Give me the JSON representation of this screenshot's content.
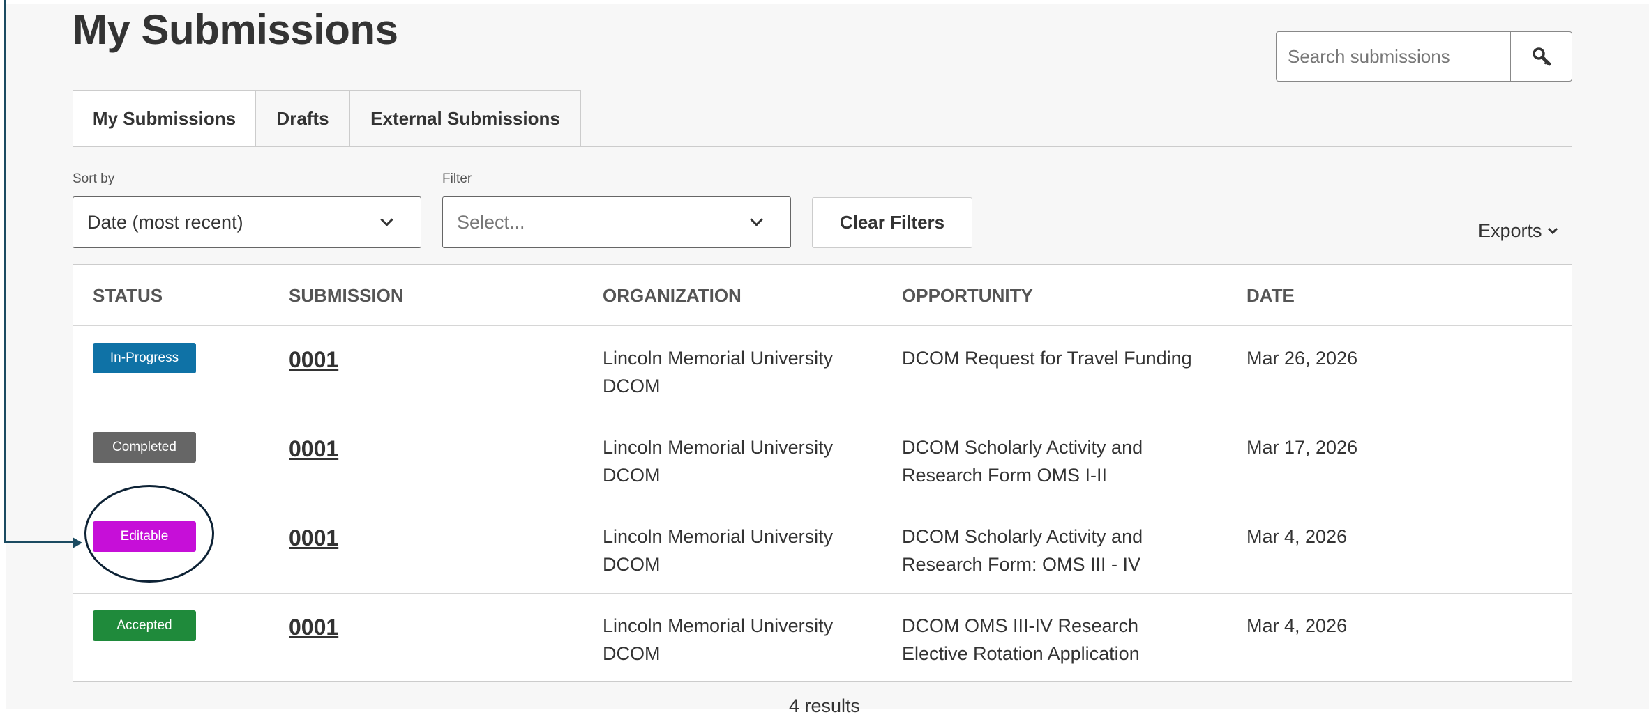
{
  "page": {
    "title": "My Submissions"
  },
  "search": {
    "placeholder": "Search submissions",
    "icon": "search-icon"
  },
  "tabs": [
    {
      "label": "My Submissions",
      "active": true
    },
    {
      "label": "Drafts",
      "active": false
    },
    {
      "label": "External Submissions",
      "active": false
    }
  ],
  "controls": {
    "sort_label": "Sort by",
    "sort_value": "Date (most recent)",
    "filter_label": "Filter",
    "filter_placeholder": "Select...",
    "clear_filters": "Clear Filters",
    "exports": "Exports"
  },
  "table": {
    "columns": [
      "STATUS",
      "SUBMISSION",
      "ORGANIZATION",
      "OPPORTUNITY",
      "DATE"
    ],
    "rows": [
      {
        "status": "In-Progress",
        "status_color": "#0f72a6",
        "submission": "0001",
        "org_line1": "Lincoln Memorial University",
        "org_line2": "DCOM",
        "opp_line1": "DCOM Request for Travel Funding",
        "opp_line2": "",
        "date": "Mar 26, 2026"
      },
      {
        "status": "Completed",
        "status_color": "#666666",
        "submission": "0001",
        "org_line1": "Lincoln Memorial University",
        "org_line2": "DCOM",
        "opp_line1": "DCOM Scholarly Activity and",
        "opp_line2": "Research Form OMS I-II",
        "date": "Mar 17, 2026"
      },
      {
        "status": "Editable",
        "status_color": "#c60fd8",
        "submission": "0001",
        "org_line1": "Lincoln Memorial University",
        "org_line2": "DCOM",
        "opp_line1": "DCOM Scholarly Activity and",
        "opp_line2": "Research Form: OMS III - IV",
        "date": "Mar 4, 2026"
      },
      {
        "status": "Accepted",
        "status_color": "#1f8a3b",
        "submission": "0001",
        "org_line1": "Lincoln Memorial University",
        "org_line2": "DCOM",
        "opp_line1": "DCOM OMS III-IV Research",
        "opp_line2": "Elective Rotation Application",
        "date": "Mar 4, 2026"
      }
    ]
  },
  "results": {
    "count_text": "4 results"
  },
  "colors": {
    "annotation": "#1b4b61",
    "circle": "#0d2235",
    "background": "#f7f7f7"
  }
}
